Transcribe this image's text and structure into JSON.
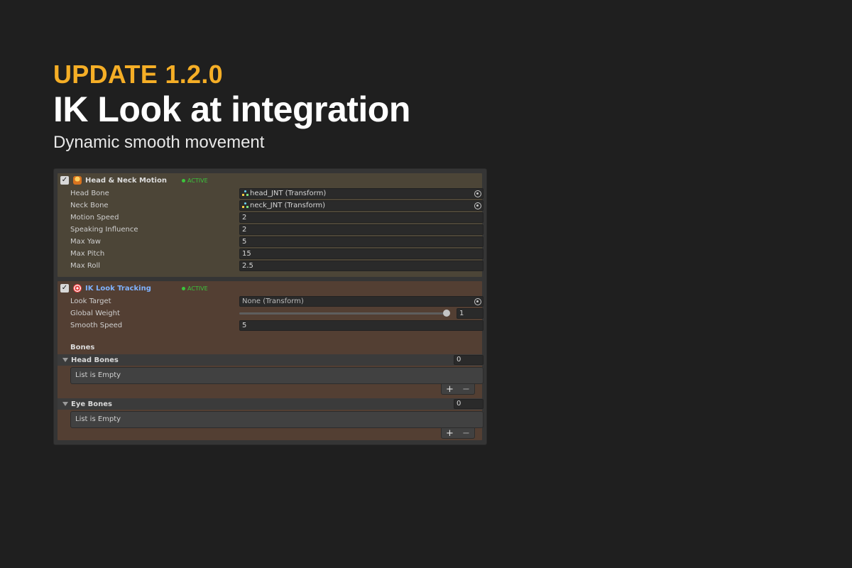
{
  "hero": {
    "version": "UPDATE 1.2.0",
    "title": "IK Look at integration",
    "subtitle": "Dynamic smooth movement"
  },
  "colors": {
    "accent": "#f5ae26",
    "active": "#3cc43c",
    "ik_title": "#7fb2ff"
  },
  "inspector": {
    "head_neck": {
      "enabled": true,
      "icon": "neck-icon",
      "title": "Head & Neck Motion",
      "status": "ACTIVE",
      "fields": {
        "head_bone": {
          "label": "Head Bone",
          "value": "head_JNT (Transform)"
        },
        "neck_bone": {
          "label": "Neck Bone",
          "value": "neck_JNT (Transform)"
        },
        "motion_speed": {
          "label": "Motion Speed",
          "value": "2"
        },
        "speaking_influence": {
          "label": "Speaking Influence",
          "value": "2"
        },
        "max_yaw": {
          "label": "Max Yaw",
          "value": "5"
        },
        "max_pitch": {
          "label": "Max Pitch",
          "value": "15"
        },
        "max_roll": {
          "label": "Max Roll",
          "value": "2.5"
        }
      }
    },
    "ik_look": {
      "enabled": true,
      "icon": "target-icon",
      "title": "IK Look Tracking",
      "status": "ACTIVE",
      "look_target": {
        "label": "Look Target",
        "value": "None (Transform)"
      },
      "global_weight": {
        "label": "Global Weight",
        "value": "1",
        "slider_fraction": 1.0
      },
      "smooth_speed": {
        "label": "Smooth Speed",
        "value": "5"
      },
      "bones_label": "Bones",
      "head_bones": {
        "label": "Head Bones",
        "count": "0",
        "empty_text": "List is Empty",
        "add": "+",
        "remove": "−"
      },
      "eye_bones": {
        "label": "Eye Bones",
        "count": "0",
        "empty_text": "List is Empty",
        "add": "+",
        "remove": "−"
      }
    }
  }
}
